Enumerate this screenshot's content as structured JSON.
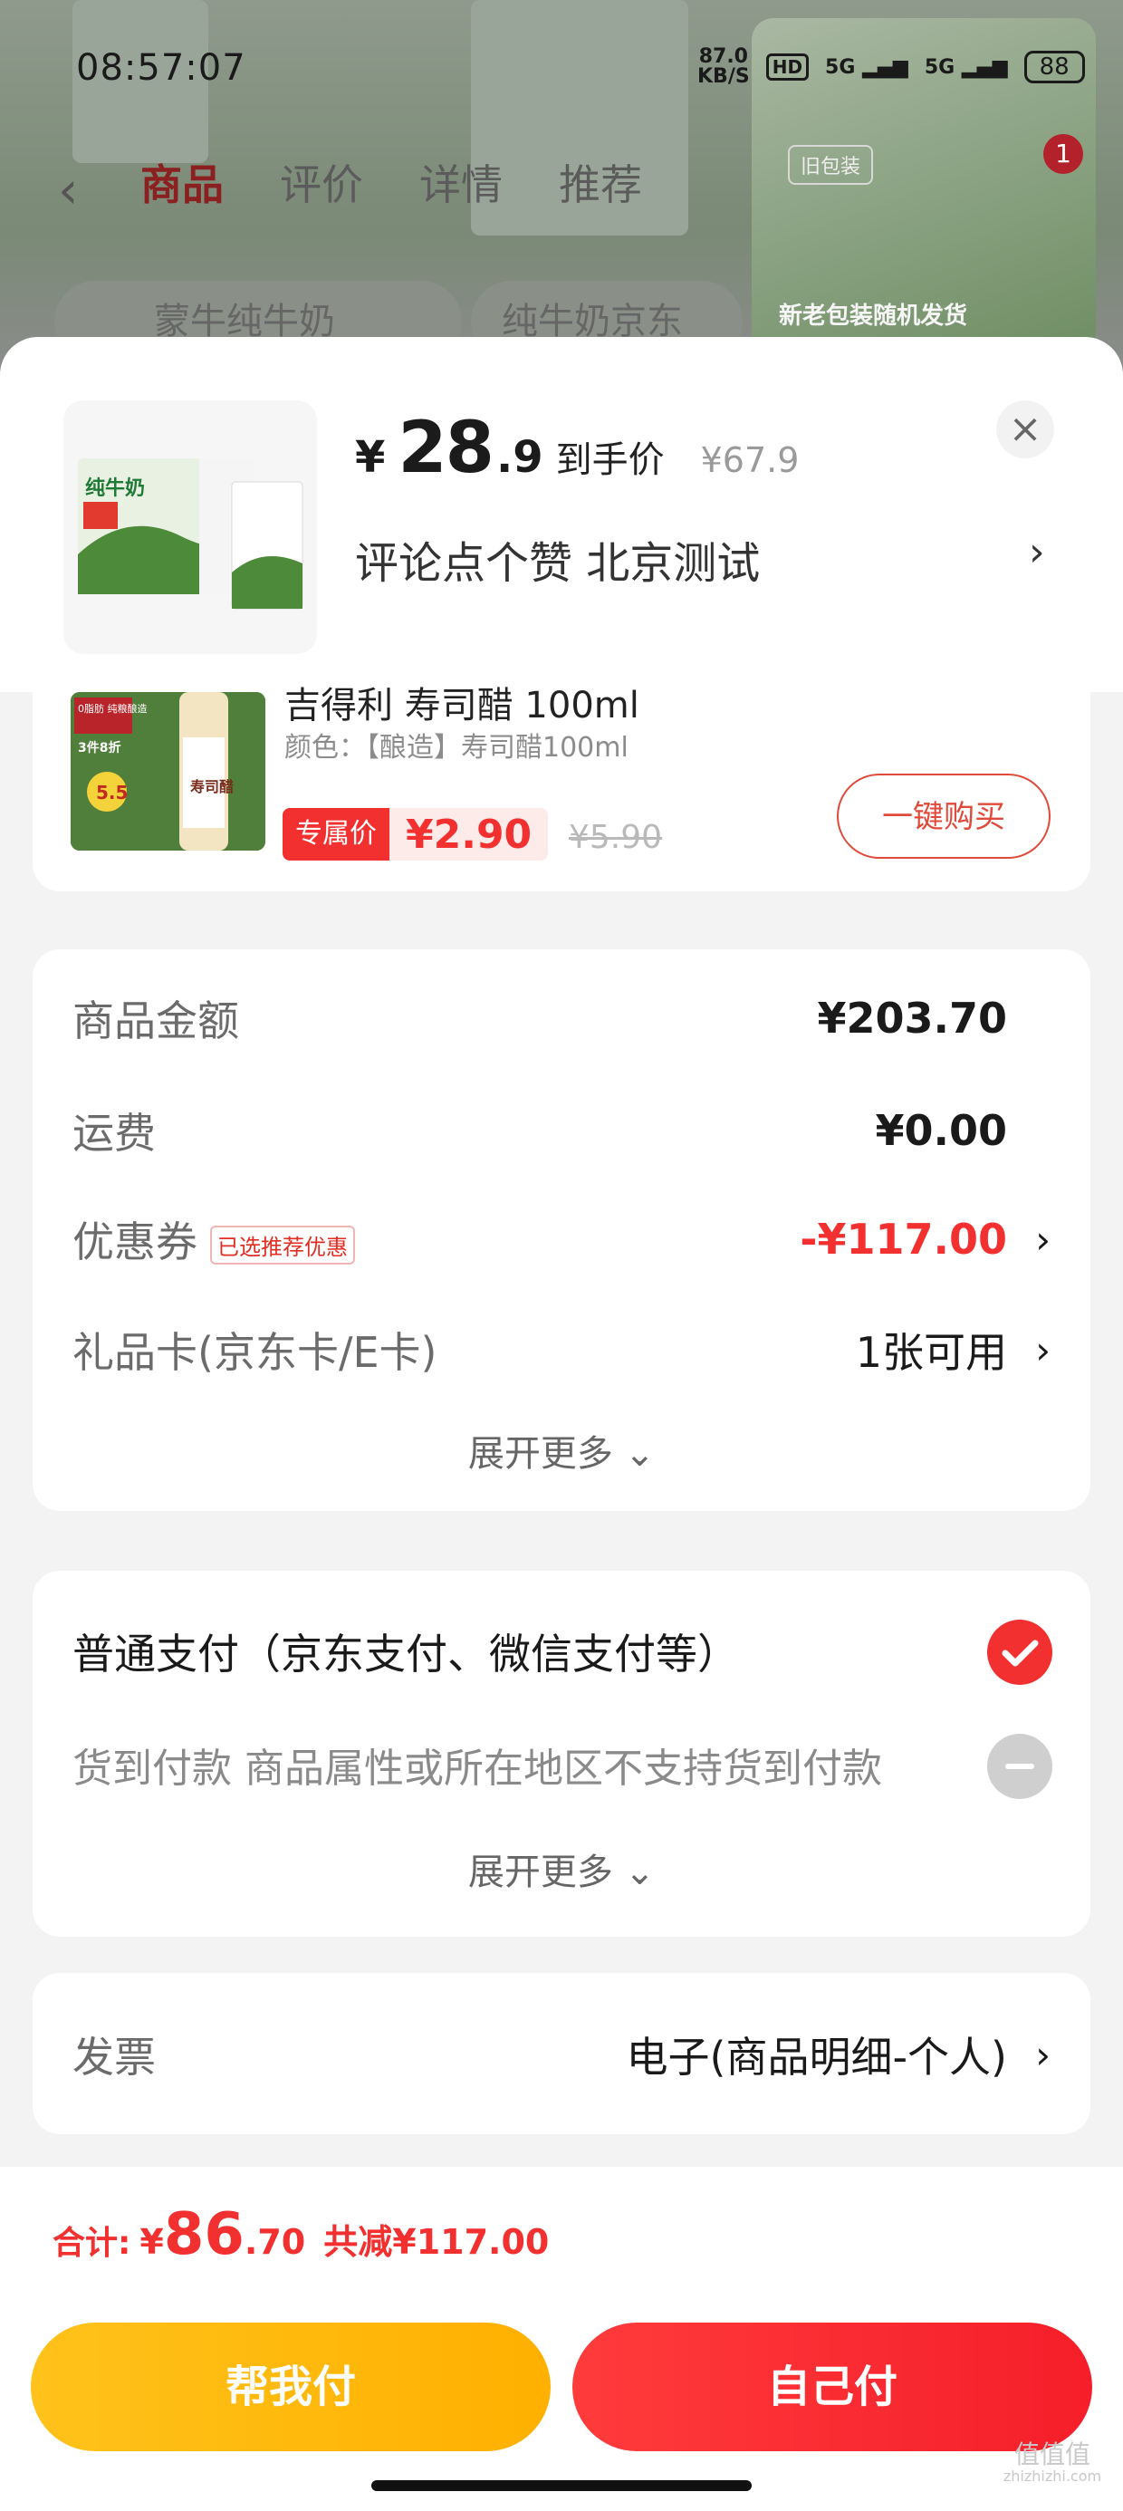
{
  "status_bar": {
    "time": "08:57:07",
    "speed": "87.0",
    "speed_unit": "KB/S",
    "hd": "HD",
    "signal_1": "5G",
    "signal_2": "5G",
    "battery": "88"
  },
  "background_page": {
    "tabs": [
      "商品",
      "评价",
      "详情",
      "推荐"
    ],
    "search_text": "蒙牛纯牛奶",
    "search_text_2": "纯牛奶京东",
    "thumb_tag": "旧包装",
    "thumb_note": "新老包装随机发货",
    "badge": "1"
  },
  "product": {
    "currency": "¥",
    "price_int": "28",
    "price_dec": ".9",
    "price_label": "到手价",
    "orig_price": "¥67.9",
    "sub": "评论点个赞  北京测试",
    "image_text": "纯牛奶"
  },
  "upsell": {
    "title": "吉得利 寿司醋 100ml",
    "spec": "颜色：【酿造】寿司醋100ml",
    "excl_tag": "专属价",
    "price": "¥2.90",
    "old_price": "¥5.90",
    "buy_label": "一键购买",
    "image_text": "寿司醋",
    "image_badge": "0脂肪 纯粮酿造",
    "image_promo": "3件8折",
    "image_price": "5.5"
  },
  "summary": {
    "goods_label": "商品金额",
    "goods_value": "¥203.70",
    "shipping_label": "运费",
    "shipping_value": "¥0.00",
    "coupon_label": "优惠券",
    "coupon_tag": "已选推荐优惠",
    "coupon_value": "-¥117.00",
    "giftcard_label": "礼品卡(京东卡/E卡)",
    "giftcard_value": "1张可用",
    "expand": "展开更多"
  },
  "payment": {
    "normal": "普通支付（京东支付、微信支付等）",
    "cod": "货到付款  商品属性或所在地区不支持货到付款",
    "expand": "展开更多"
  },
  "invoice": {
    "label": "发票",
    "value": "电子(商品明细-个人)"
  },
  "footer": {
    "total_label": "合计:",
    "total_sym": "¥",
    "total_int": "86",
    "total_dec": ".70",
    "saved": "共减¥117.00",
    "help_pay": "帮我付",
    "self_pay": "自己付"
  },
  "watermark": {
    "main": "值值值",
    "sub": "zhizhizhi.com"
  },
  "colors": {
    "accent": "#f23030",
    "yellow": "#ffb000",
    "sheet_bg": "#f3f3f3"
  }
}
